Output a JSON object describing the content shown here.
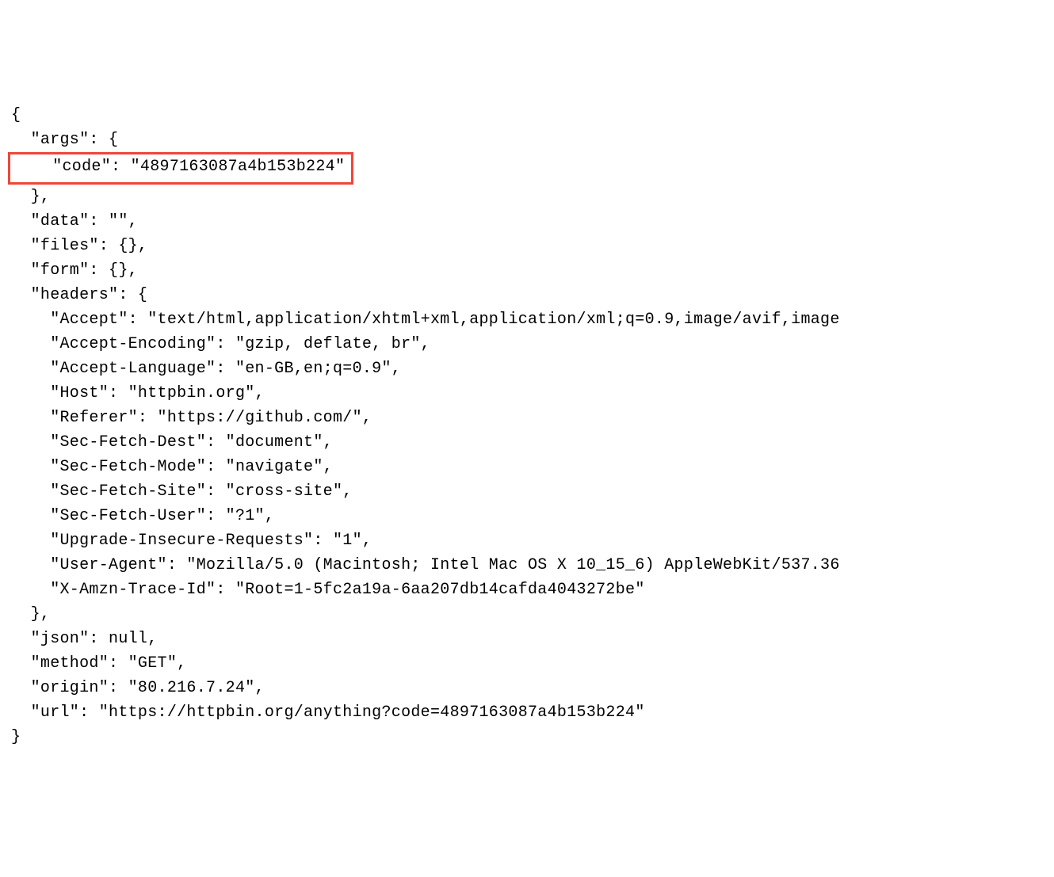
{
  "json_response": {
    "open_brace": "{",
    "args_line": "  \"args\": {",
    "code_key": "    \"code\": ",
    "code_value": "\"4897163087a4b153b224\"",
    "args_close": "  },",
    "data_line": "  \"data\": \"\",",
    "files_line": "  \"files\": {},",
    "form_line": "  \"form\": {},",
    "headers_open": "  \"headers\": {",
    "accept_line": "    \"Accept\": \"text/html,application/xhtml+xml,application/xml;q=0.9,image/avif,image",
    "accept_encoding_line": "    \"Accept-Encoding\": \"gzip, deflate, br\",",
    "accept_language_line": "    \"Accept-Language\": \"en-GB,en;q=0.9\",",
    "host_line": "    \"Host\": \"httpbin.org\",",
    "referer_line": "    \"Referer\": \"https://github.com/\",",
    "sec_fetch_dest_line": "    \"Sec-Fetch-Dest\": \"document\",",
    "sec_fetch_mode_line": "    \"Sec-Fetch-Mode\": \"navigate\",",
    "sec_fetch_site_line": "    \"Sec-Fetch-Site\": \"cross-site\",",
    "sec_fetch_user_line": "    \"Sec-Fetch-User\": \"?1\",",
    "upgrade_insecure_line": "    \"Upgrade-Insecure-Requests\": \"1\",",
    "user_agent_line": "    \"User-Agent\": \"Mozilla/5.0 (Macintosh; Intel Mac OS X 10_15_6) AppleWebKit/537.36",
    "x_amzn_trace_line": "    \"X-Amzn-Trace-Id\": \"Root=1-5fc2a19a-6aa207db14cafda4043272be\"",
    "headers_close": "  },",
    "json_line": "  \"json\": null,",
    "method_line": "  \"method\": \"GET\",",
    "origin_line": "  \"origin\": \"80.216.7.24\",",
    "url_line": "  \"url\": \"https://httpbin.org/anything?code=4897163087a4b153b224\"",
    "close_brace": "}"
  }
}
